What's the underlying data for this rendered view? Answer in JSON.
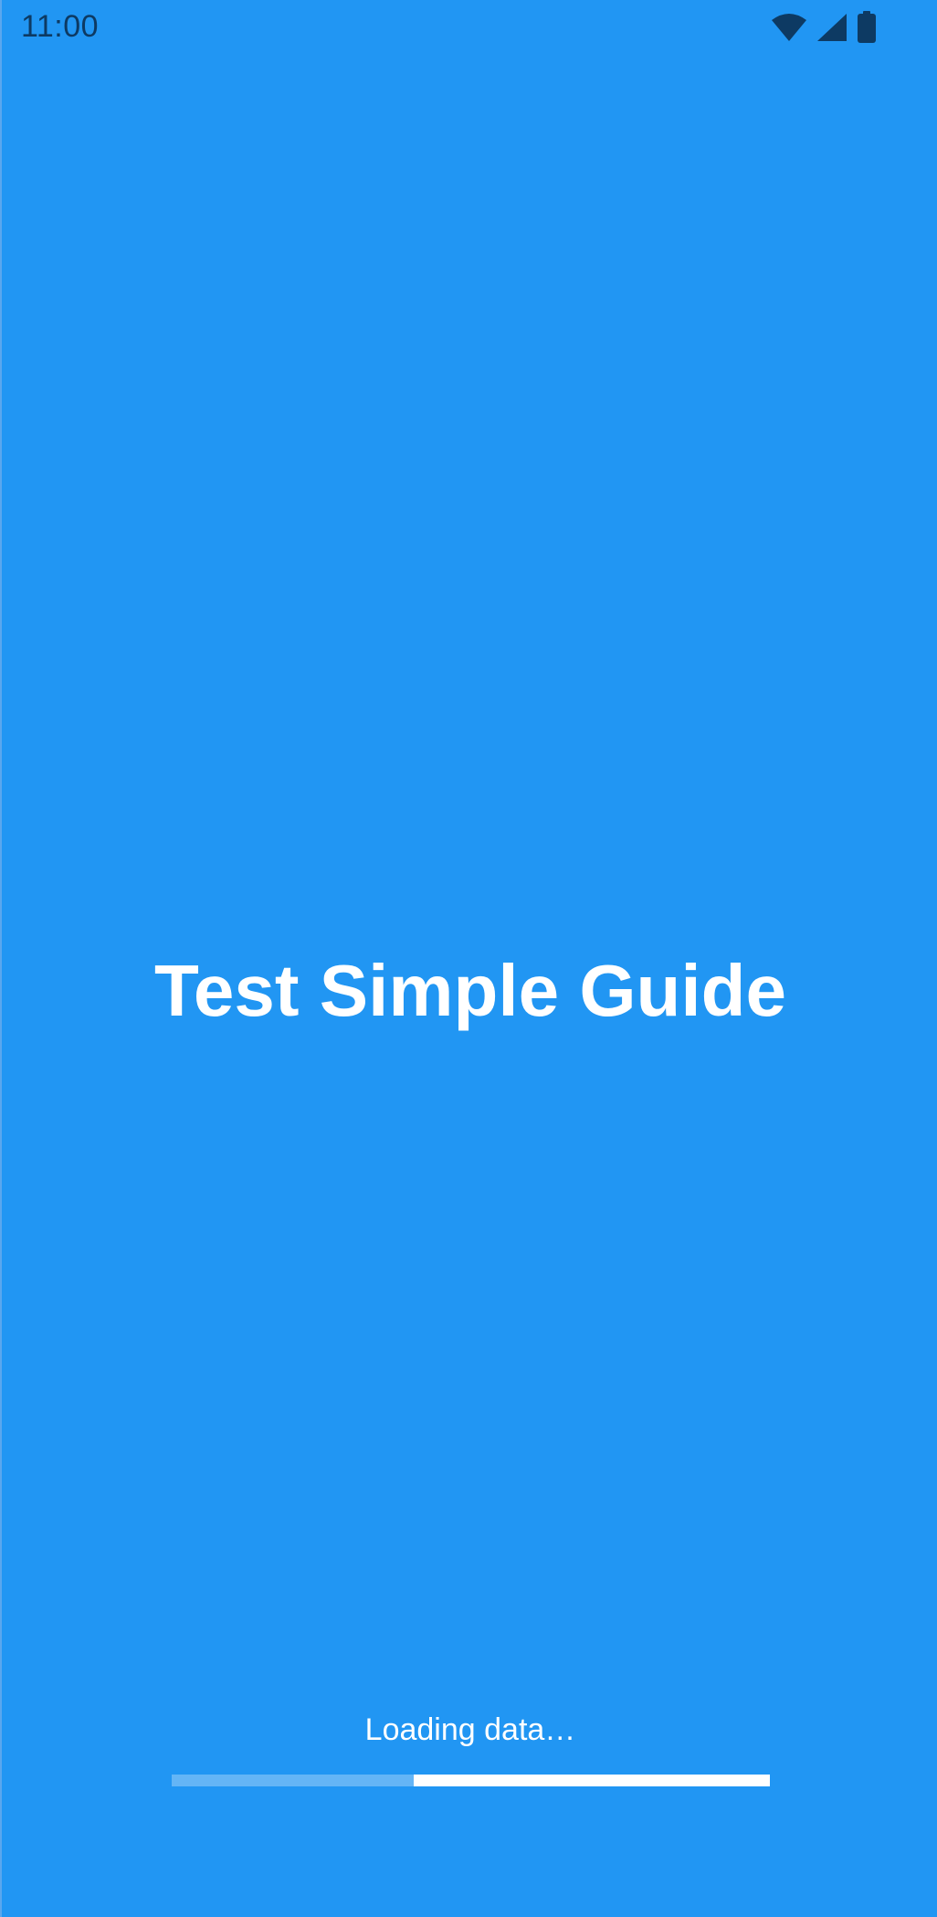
{
  "status_bar": {
    "time": "11:00",
    "icons": [
      "wifi-icon",
      "cellular-signal-icon",
      "battery-icon"
    ]
  },
  "app": {
    "title": "Test Simple Guide"
  },
  "loading": {
    "label": "Loading data…",
    "progress_start": 0.405,
    "progress_end": 1.0
  },
  "colors": {
    "background": "#2196F3",
    "track": "#64B5F6",
    "bar": "#FFFFFF",
    "status_icons": "#0D3A63"
  }
}
